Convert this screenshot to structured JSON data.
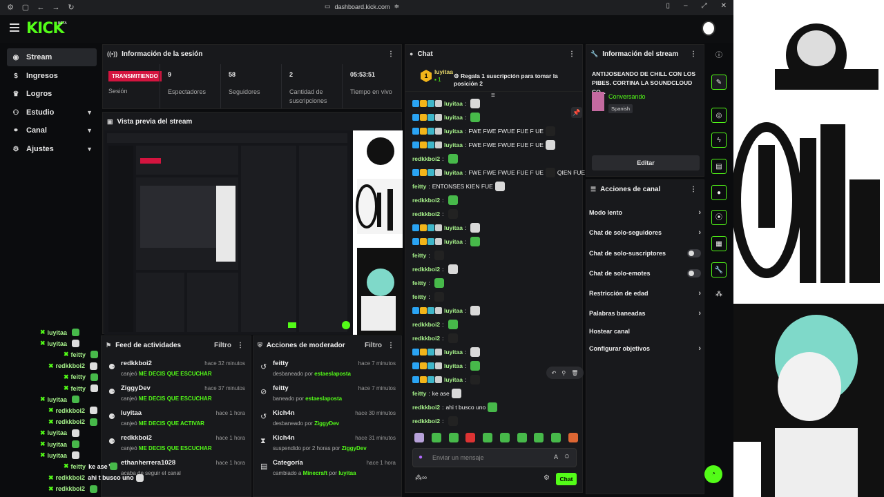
{
  "browser": {
    "url": "dashboard.kick.com"
  },
  "app": {
    "logo": "KICK",
    "beta": "BETA"
  },
  "sidebar": {
    "items": [
      {
        "label": "Stream",
        "icon": "stream-icon"
      },
      {
        "label": "Ingresos",
        "icon": "money-icon"
      },
      {
        "label": "Logros",
        "icon": "trophy-icon"
      },
      {
        "label": "Estudio",
        "icon": "studio-icon"
      },
      {
        "label": "Canal",
        "icon": "channel-icon"
      },
      {
        "label": "Ajustes",
        "icon": "gear-icon"
      }
    ]
  },
  "session": {
    "title": "Información de la sesión",
    "live": "TRANSMITIENDO",
    "live_label": "Sesión",
    "viewers": "9",
    "viewers_label": "Espectadores",
    "followers": "58",
    "followers_label": "Seguidores",
    "subs": "2",
    "subs_label": "Cantidad de suscripciones",
    "time": "05:53:51",
    "time_label": "Tiempo en vivo"
  },
  "preview": {
    "title": "Vista previa del stream"
  },
  "feed": {
    "title": "Feed de actividades",
    "filter": "Filtro",
    "rows": [
      {
        "name": "redkkboi2",
        "time": "hace 32 minutos",
        "desc": "canjeó",
        "hl": "ME DECIS QUE ESCUCHAR"
      },
      {
        "name": "ZiggyDev",
        "time": "hace 37 minutos",
        "desc": "canjeó",
        "hl": "ME DECIS QUE ESCUCHAR"
      },
      {
        "name": "luyitaa",
        "time": "hace 1 hora",
        "desc": "canjeó",
        "hl": "ME DECIS QUE ACTIVAR"
      },
      {
        "name": "redkkboi2",
        "time": "hace 1 hora",
        "desc": "canjeó",
        "hl": "ME DECIS QUE ESCUCHAR"
      },
      {
        "name": "ethanherrera1028",
        "time": "hace 1 hora",
        "desc": "acaba de seguir el canal",
        "hl": ""
      }
    ]
  },
  "modactions": {
    "title": "Acciones de moderador",
    "filter": "Filtro",
    "rows": [
      {
        "name": "feitty",
        "time": "hace 7 minutos",
        "desc": "desbaneado por",
        "hl": "estaeslaposta"
      },
      {
        "name": "feitty",
        "time": "hace 7 minutos",
        "desc": "baneado por",
        "hl": "estaeslaposta"
      },
      {
        "name": "Kich4n",
        "time": "hace 30 minutos",
        "desc": "desbaneado por",
        "hl": "ZiggyDev"
      },
      {
        "name": "Kich4n",
        "time": "hace 31 minutos",
        "desc": "suspendido por 2 horas por",
        "hl": "ZiggyDev"
      },
      {
        "name": "Categoría",
        "time": "hace 1 hora",
        "desc": "cambiado a",
        "hl": "Minecraft",
        "desc2": "por",
        "hl2": "luyitaa"
      }
    ]
  },
  "chat": {
    "title": "Chat",
    "top_user": "luyitaa",
    "top_count": "1",
    "top_rank": "1",
    "gift_text": "Regala 1 suscripción para tomar la posición 2",
    "placeholder": "Enviar un mensaje",
    "send": "Chat",
    "messages": [
      {
        "user": "luyitaa",
        "color": "#a7f28b",
        "msg": ""
      },
      {
        "user": "luyitaa",
        "color": "#a7f28b",
        "msg": ""
      },
      {
        "user": "luyitaa",
        "color": "#a7f28b",
        "msg": "FWE FWE FWUE FUE F UE"
      },
      {
        "user": "luyitaa",
        "color": "#a7f28b",
        "msg": "FWE FWE FWUE FUE F UE"
      },
      {
        "user": "redkkboi2",
        "color": "#a7f28b",
        "msg": ""
      },
      {
        "user": "luyitaa",
        "color": "#a7f28b",
        "msg": "FWE FWE FWUE FUE F UE",
        "extra": "QIEN FUE"
      },
      {
        "user": "feitty",
        "color": "#a7f28b",
        "msg": "ENTONSES KIEN FUE"
      },
      {
        "user": "redkkboi2",
        "color": "#a7f28b",
        "msg": ""
      },
      {
        "user": "redkkboi2",
        "color": "#a7f28b",
        "msg": ""
      },
      {
        "user": "luyitaa",
        "color": "#a7f28b",
        "msg": ""
      },
      {
        "user": "luyitaa",
        "color": "#a7f28b",
        "msg": ""
      },
      {
        "user": "feitty",
        "color": "#a7f28b",
        "msg": ""
      },
      {
        "user": "redkkboi2",
        "color": "#a7f28b",
        "msg": ""
      },
      {
        "user": "feitty",
        "color": "#a7f28b",
        "msg": ""
      },
      {
        "user": "feitty",
        "color": "#a7f28b",
        "msg": ""
      },
      {
        "user": "luyitaa",
        "color": "#a7f28b",
        "msg": ""
      },
      {
        "user": "redkkboi2",
        "color": "#a7f28b",
        "msg": ""
      },
      {
        "user": "redkkboi2",
        "color": "#a7f28b",
        "msg": ""
      },
      {
        "user": "luyitaa",
        "color": "#a7f28b",
        "msg": ""
      },
      {
        "user": "luyitaa",
        "color": "#a7f28b",
        "msg": ""
      },
      {
        "user": "luyitaa",
        "color": "#a7f28b",
        "msg": ""
      },
      {
        "user": "feitty",
        "color": "#a7f28b",
        "msg": "ke ase"
      },
      {
        "user": "redkkboi2",
        "color": "#a7f28b",
        "msg": "ahi t busco uno"
      },
      {
        "user": "redkkboi2",
        "color": "#a7f28b",
        "msg": ""
      }
    ]
  },
  "streaminfo": {
    "title": "Información del stream",
    "stream_title": "ANTIJOSEANDO DE CHILL CON LOS PIBES. CORTINA LA SOUNDCLOUD CO...",
    "category": "Conversando",
    "language": "Spanish",
    "edit": "Editar"
  },
  "actions": {
    "title": "Acciones de canal",
    "items": [
      {
        "label": "Modo lento",
        "kind": "chev"
      },
      {
        "label": "Chat de solo-seguidores",
        "kind": "chev"
      },
      {
        "label": "Chat de solo-suscriptores",
        "kind": "toggle"
      },
      {
        "label": "Chat de solo-emotes",
        "kind": "toggle"
      },
      {
        "label": "Restricción de edad",
        "kind": "chev"
      },
      {
        "label": "Palabras baneadas",
        "kind": "chev"
      },
      {
        "label": "Hostear canal",
        "kind": "none"
      },
      {
        "label": "Configurar objetivos",
        "kind": "chev"
      }
    ]
  },
  "overlay_chat": [
    {
      "user": "luyitaa",
      "msg": ""
    },
    {
      "user": "luyitaa",
      "msg": ""
    },
    {
      "user": "feitty",
      "msg": ""
    },
    {
      "user": "redkkboi2",
      "msg": ""
    },
    {
      "user": "feitty",
      "msg": ""
    },
    {
      "user": "feitty",
      "msg": ""
    },
    {
      "user": "luyitaa",
      "msg": ""
    },
    {
      "user": "redkkboi2",
      "msg": ""
    },
    {
      "user": "redkkboi2",
      "msg": ""
    },
    {
      "user": "luyitaa",
      "msg": ""
    },
    {
      "user": "luyitaa",
      "msg": ""
    },
    {
      "user": "luyitaa",
      "msg": ""
    },
    {
      "user": "feitty",
      "msg": "ke ase"
    },
    {
      "user": "redkkboi2",
      "msg": "ahi t busco uno"
    },
    {
      "user": "redkkboi2",
      "msg": ""
    }
  ],
  "colors": {
    "accent": "#53fc18",
    "live": "#d4143f",
    "panel": "#18191c"
  }
}
